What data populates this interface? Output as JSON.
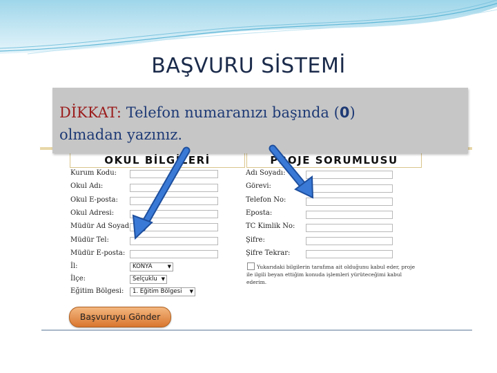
{
  "slide": {
    "title": "BAŞVURU SİSTEMİ"
  },
  "warning": {
    "keyword": "DİKKAT:",
    "text_before": "Telefon numaranızı başında (",
    "zero": "0",
    "text_after": ")",
    "line2": "olmadan yazınız."
  },
  "form": {
    "school_section_title": "OKUL BİLGİLERİ",
    "project_section_title": "PROJE SORUMLUSU",
    "school_fields": [
      {
        "label": "Kurum Kodu:"
      },
      {
        "label": "Okul Adı:"
      },
      {
        "label": "Okul E-posta:"
      },
      {
        "label": "Okul Adresi:"
      },
      {
        "label": "Müdür Ad Soyad:"
      },
      {
        "label": "Müdür Tel:"
      },
      {
        "label": "Müdür E-posta:"
      }
    ],
    "school_selects": [
      {
        "label": "İl:",
        "value": "KONYA"
      },
      {
        "label": "İlçe:",
        "value": "Selçuklu"
      },
      {
        "label": "Eğitim Bölgesi:",
        "value": "1. Eğitim Bölgesi"
      }
    ],
    "project_fields": [
      {
        "label": "Adı Soyadı:"
      },
      {
        "label": "Görevi:"
      },
      {
        "label": "Telefon No:"
      },
      {
        "label": "Eposta:"
      },
      {
        "label": "TC Kimlik No:"
      },
      {
        "label": "Şifre:"
      },
      {
        "label": "Şifre Tekrar:"
      }
    ],
    "consent_text": "Yukarıdaki bilgilerin tarafıma ait olduğunu kabul eder, proje ile ilgili beyan ettiğim konuda işlemleri yürüteceğimi kabul ederim.",
    "submit_label": "Başvuruyu Gönder"
  },
  "colors": {
    "arrow": "#2e68c8",
    "title": "#1a2a4a",
    "warning_bg": "#c6c6c6",
    "warning_keyword": "#9b1d1d",
    "warning_text": "#1e3a75",
    "button": "#e08a45"
  }
}
